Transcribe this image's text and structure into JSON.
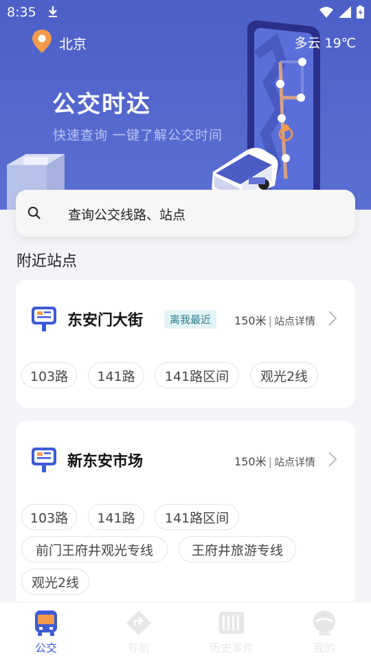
{
  "status_bar": {
    "time": "8:35"
  },
  "header": {
    "city": "北京",
    "weather": "多云 19℃",
    "title": "公交时达",
    "subtitle": "快速查询 一键了解公交时间"
  },
  "search": {
    "placeholder": "查询公交线路、站点"
  },
  "nearby": {
    "section_title": "附近站点",
    "stops": [
      {
        "name": "东安门大街",
        "badge": "离我最近",
        "distance": "150米",
        "separator": "|",
        "detail_link": "站点详情",
        "routes": [
          "103路",
          "141路",
          "141路区间",
          "观光2线"
        ]
      },
      {
        "name": "新东安市场",
        "distance": "150米",
        "separator": "|",
        "detail_link": "站点详情",
        "routes": [
          "103路",
          "141路",
          "141路区间",
          "前门王府井观光专线",
          "王府井旅游专线",
          "观光2线"
        ]
      }
    ]
  },
  "tabbar": {
    "tabs": [
      {
        "label": "公交",
        "icon": "bus-icon",
        "active": true
      },
      {
        "label": "导航",
        "icon": "navigation-icon",
        "active": false
      },
      {
        "label": "历史事件",
        "icon": "history-icon",
        "active": false
      },
      {
        "label": "我的",
        "icon": "profile-icon",
        "active": false
      }
    ]
  },
  "colors": {
    "hero": "#4d5fc8",
    "accent": "#3d5bd6",
    "badge_bg": "#e3f3f6",
    "location_pin": "#f39a4a"
  }
}
